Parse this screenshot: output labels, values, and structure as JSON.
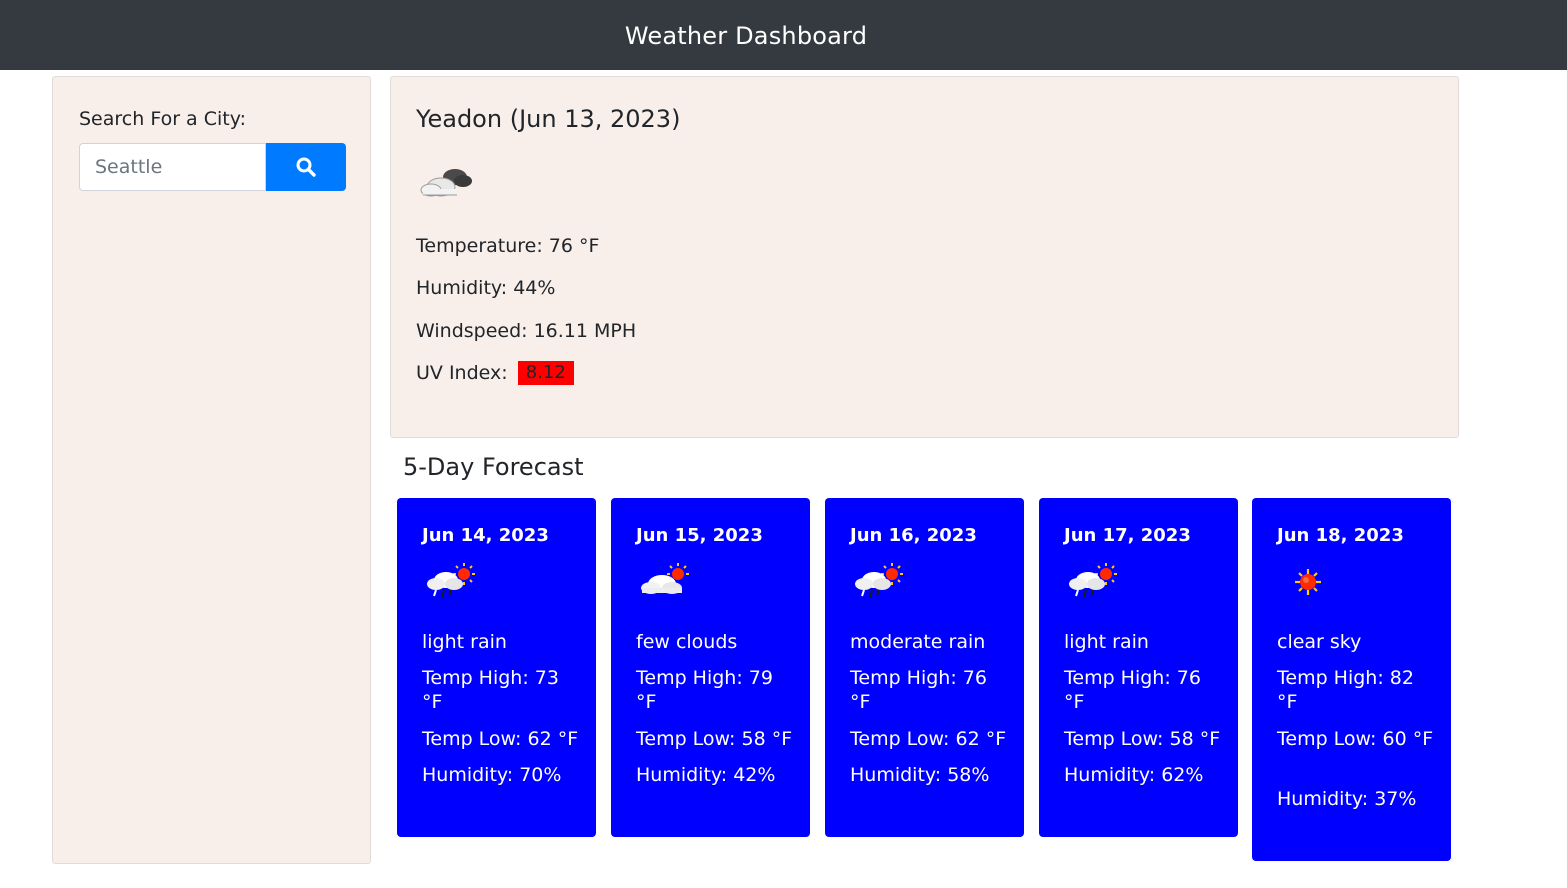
{
  "header": {
    "title": "Weather Dashboard"
  },
  "search": {
    "label": "Search For a City:",
    "placeholder": "Seattle",
    "value": "",
    "button_icon": "search-icon",
    "button_color": "#007bff"
  },
  "current": {
    "heading": "Yeadon (Jun 13, 2023)",
    "icon": "cloudy-icon",
    "temperature": "Temperature: 76 °F",
    "humidity": "Humidity: 44%",
    "windspeed": "Windspeed: 16.11 MPH",
    "uv_label": "UV Index:",
    "uv_value": "8.12",
    "uv_color": "#ff0000"
  },
  "forecast": {
    "title": "5-Day Forecast",
    "card_color": "#0000ff",
    "days": [
      {
        "date": "Jun 14, 2023",
        "icon": "rain-sun-icon",
        "description": "light rain",
        "high": "Temp High: 73 °F",
        "low": "Temp Low: 62 °F",
        "humidity": "Humidity: 70%"
      },
      {
        "date": "Jun 15, 2023",
        "icon": "sun-cloud-icon",
        "description": "few clouds",
        "high": "Temp High: 79 °F",
        "low": "Temp Low: 58 °F",
        "humidity": "Humidity: 42%"
      },
      {
        "date": "Jun 16, 2023",
        "icon": "rain-sun-icon",
        "description": "moderate rain",
        "high": "Temp High: 76 °F",
        "low": "Temp Low: 62 °F",
        "humidity": "Humidity: 58%"
      },
      {
        "date": "Jun 17, 2023",
        "icon": "rain-sun-icon",
        "description": "light rain",
        "high": "Temp High: 76 °F",
        "low": "Temp Low: 58 °F",
        "humidity": "Humidity: 62%"
      },
      {
        "date": "Jun 18, 2023",
        "icon": "sun-icon",
        "description": "clear sky",
        "high": "Temp High: 82 °F",
        "low": "Temp Low: 60 °F",
        "humidity": "Humidity: 37%"
      }
    ]
  }
}
